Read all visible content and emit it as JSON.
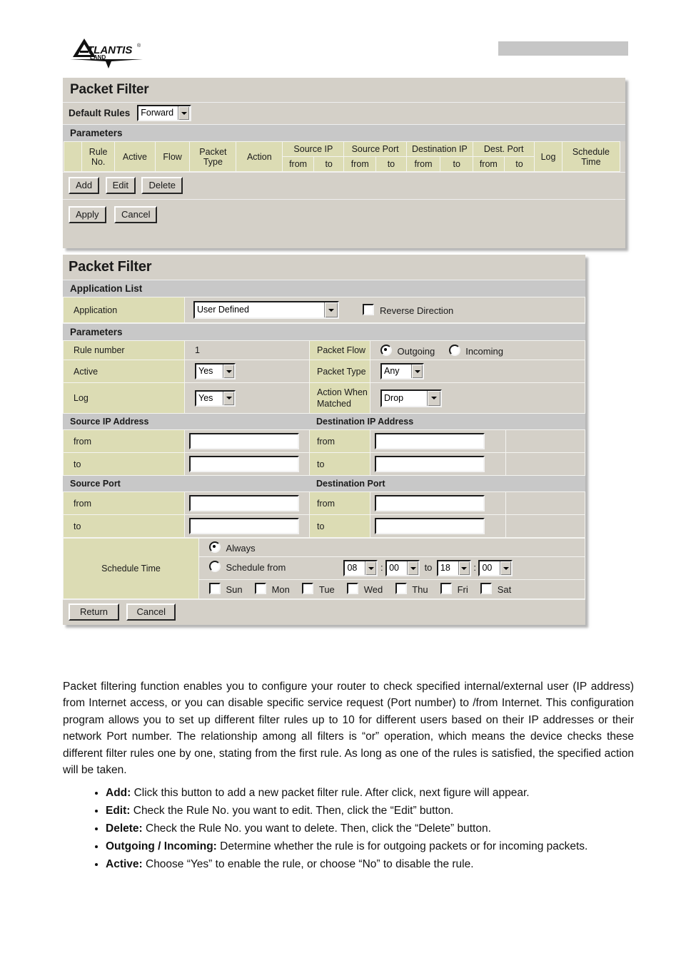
{
  "header": {
    "logo_name": "ATLANTIS LAND",
    "logo_main": "TLANTIS",
    "logo_sub": "LAND",
    "placeholder_bar": ""
  },
  "list_panel": {
    "title": "Packet Filter",
    "default_rules": {
      "label": "Default Rules",
      "value": "Forward"
    },
    "parameters_label": "Parameters",
    "columns": [
      {
        "label": "Rule No.",
        "sub": []
      },
      {
        "label": "Active",
        "sub": []
      },
      {
        "label": "Flow",
        "sub": []
      },
      {
        "label": "Packet Type",
        "sub": []
      },
      {
        "label": "Action",
        "sub": []
      },
      {
        "label": "Source IP",
        "sub": [
          "from",
          "to"
        ]
      },
      {
        "label": "Source Port",
        "sub": [
          "from",
          "to"
        ]
      },
      {
        "label": "Destination IP",
        "sub": [
          "from",
          "to"
        ]
      },
      {
        "label": "Dest. Port",
        "sub": [
          "from",
          "to"
        ]
      },
      {
        "label": "Log",
        "sub": []
      },
      {
        "label": "Schedule Time",
        "sub": []
      }
    ],
    "rows": [],
    "buttons": {
      "add": "Add",
      "edit": "Edit",
      "delete": "Delete",
      "apply": "Apply",
      "cancel": "Cancel"
    }
  },
  "edit_panel": {
    "title": "Packet Filter",
    "application_list": {
      "section_label": "Application List",
      "application_label": "Application",
      "application_value": "User Defined",
      "reverse_direction_label": "Reverse Direction",
      "reverse_direction_checked": false
    },
    "parameters_label": "Parameters",
    "rule_number_label": "Rule number",
    "rule_number_value": "1",
    "packet_flow_label": "Packet Flow",
    "packet_flow_options": [
      "Outgoing",
      "Incoming"
    ],
    "packet_flow_selected": "Outgoing",
    "active_label": "Active",
    "active_value": "Yes",
    "packet_type_label": "Packet Type",
    "packet_type_value": "Any",
    "log_label": "Log",
    "log_value": "Yes",
    "action_label": "Action When Matched",
    "action_value": "Drop",
    "source_ip_label": "Source IP Address",
    "destination_ip_label": "Destination IP Address",
    "source_port_label": "Source Port",
    "destination_port_label": "Destination Port",
    "from_label": "from",
    "to_label": "to",
    "source_ip_from": "",
    "source_ip_to": "",
    "dest_ip_from": "",
    "dest_ip_to": "",
    "source_port_from": "",
    "source_port_to": "",
    "dest_port_from": "",
    "dest_port_to": "",
    "schedule": {
      "label": "Schedule Time",
      "always_label": "Always",
      "schedule_from_label": "Schedule from",
      "selected": "Always",
      "start_hour": "08",
      "start_minute": "00",
      "to_label": "to",
      "end_hour": "18",
      "end_minute": "00",
      "days": [
        {
          "label": "Sun",
          "checked": false
        },
        {
          "label": "Mon",
          "checked": false
        },
        {
          "label": "Tue",
          "checked": false
        },
        {
          "label": "Wed",
          "checked": false
        },
        {
          "label": "Thu",
          "checked": false
        },
        {
          "label": "Fri",
          "checked": false
        },
        {
          "label": "Sat",
          "checked": false
        }
      ]
    },
    "buttons": {
      "return": "Return",
      "cancel": "Cancel"
    }
  },
  "content": {
    "paragraph": "Packet filtering function enables you to configure your router to check specified internal/external user (IP address) from Internet access, or you can disable specific service request (Port number) to /from Internet. This configuration program allows you to set up different filter rules up to 10 for different users based on their IP addresses or their network Port number. The relationship among all filters is “or” operation, which means the device checks these different filter rules one by one, stating from the first rule. As long as one of the rules is satisfied, the specified action will be taken.",
    "bullets": [
      {
        "term": "Add:",
        "text": " Click this button to add a new packet filter rule. After click, next figure will appear."
      },
      {
        "term": "Edit:",
        "text": " Check the Rule No. you want to edit. Then, click the “Edit” button."
      },
      {
        "term": "Delete:",
        "text": " Check the Rule No. you want to delete. Then, click the “Delete” button."
      },
      {
        "term": "Outgoing /  Incoming:",
        "text": " Determine whether the rule is for outgoing packets or for incoming packets."
      },
      {
        "term": "Active:",
        "text": " Choose “Yes” to enable the rule, or choose “No” to disable the rule."
      }
    ]
  },
  "colors": {
    "panel_gray": "#d4d0c8",
    "section_gray": "#c8c8c8",
    "khaki": "#dcdcb4",
    "placeholder_gray": "#c6c6c6"
  }
}
